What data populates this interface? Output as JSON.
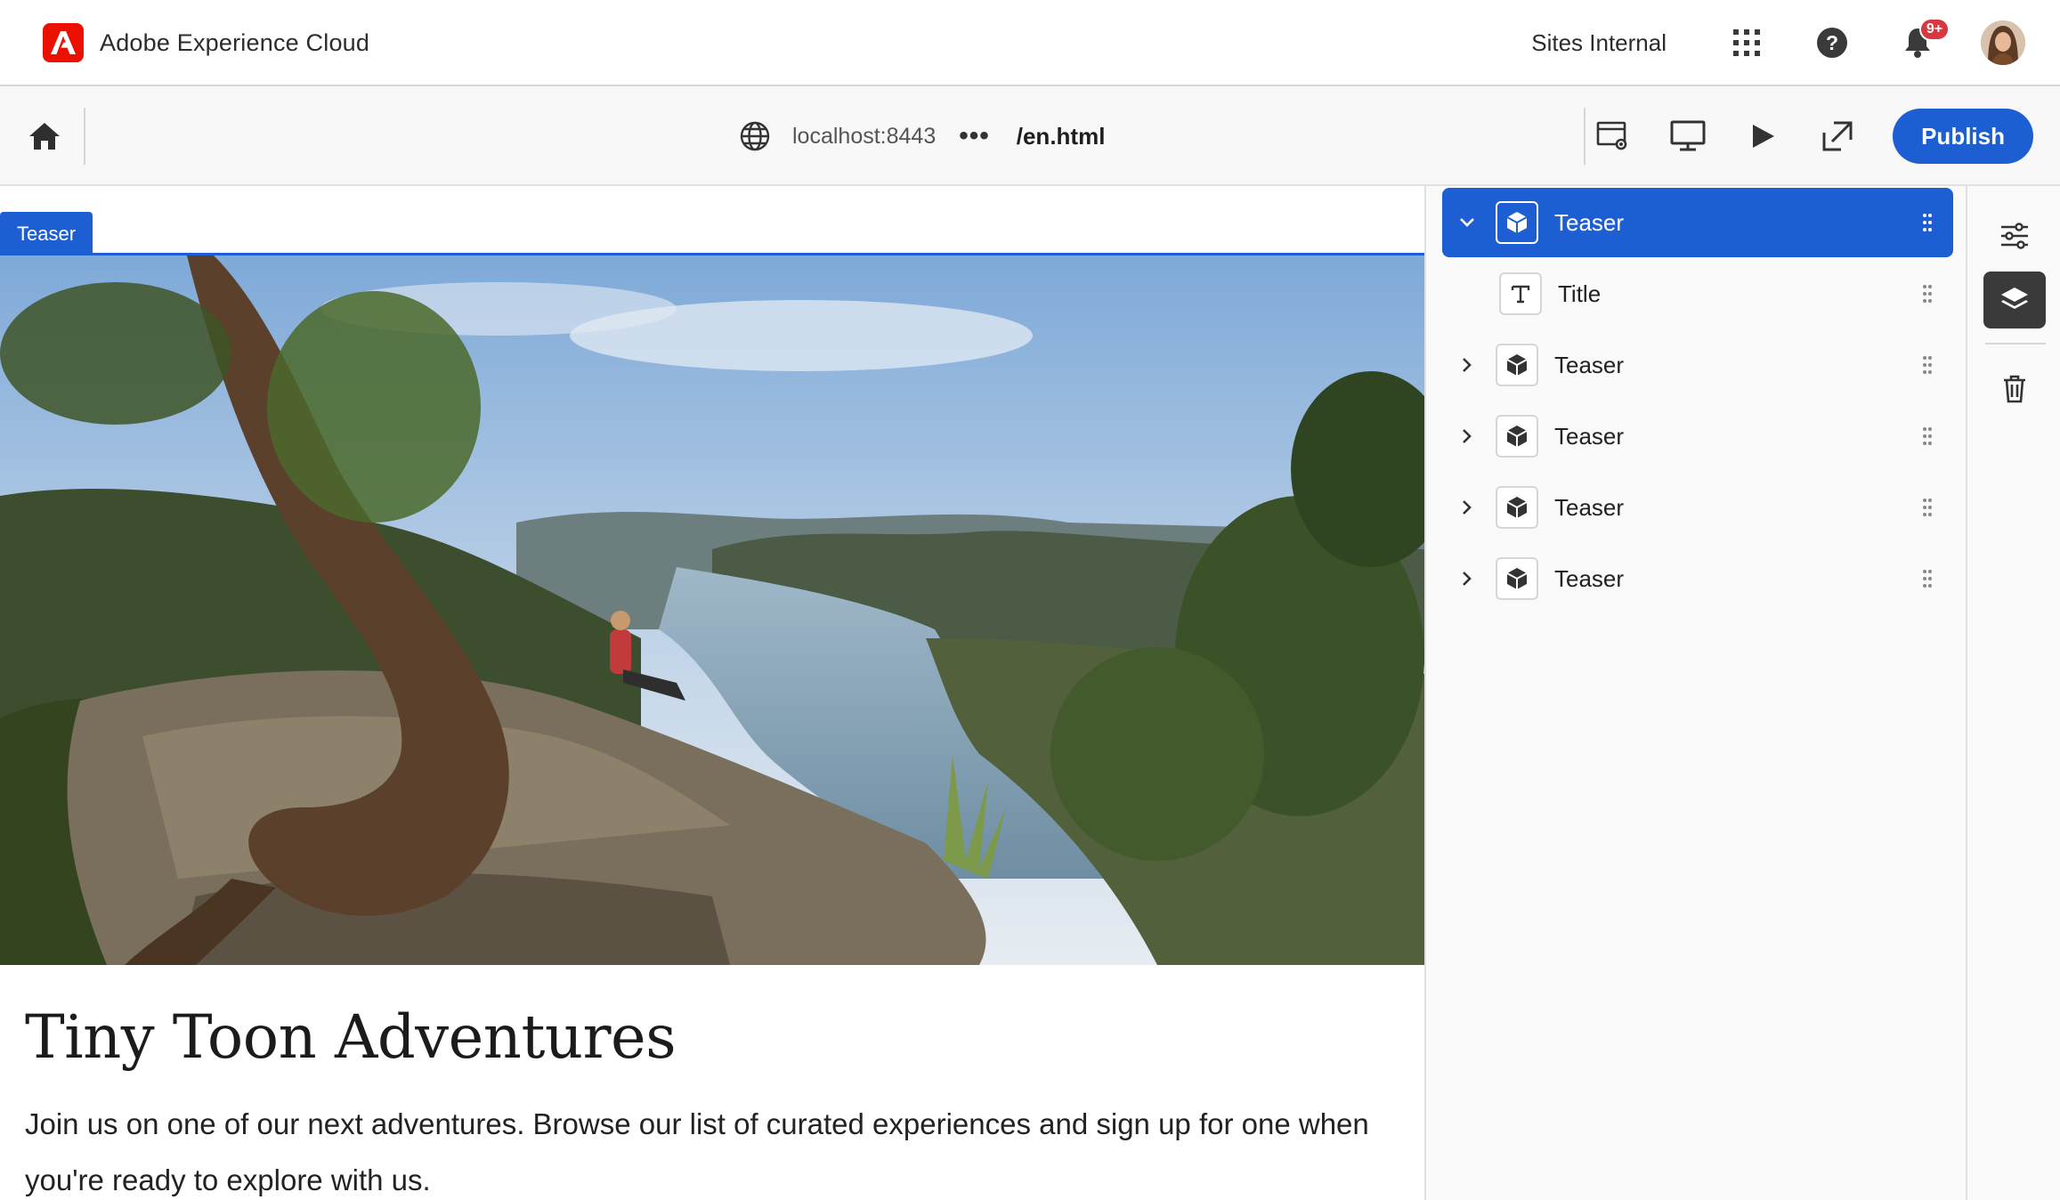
{
  "shell": {
    "brand_name": "Adobe Experience Cloud",
    "org_name": "Sites Internal",
    "notification_badge": "9+",
    "icons": [
      "app-switcher-icon",
      "help-icon",
      "bell-icon"
    ]
  },
  "toolbar": {
    "url_host": "localhost:8443",
    "url_more": "•••",
    "url_path": "/en.html",
    "publish_label": "Publish",
    "icons": [
      "home-icon",
      "globe-icon",
      "page-properties-icon",
      "desktop-icon",
      "preview-play-icon",
      "open-external-icon"
    ]
  },
  "canvas": {
    "component_tag": "Teaser",
    "teaser_title": "Tiny Toon Adventures",
    "teaser_description": "Join us on one of our next adventures. Browse our list of curated experiences and sign up for one when you're ready to explore with us."
  },
  "tree": {
    "items": [
      {
        "label": "Teaser",
        "expanded": true,
        "selected": true,
        "icon": "cube-icon"
      },
      {
        "label": "Title",
        "child": true,
        "icon": "text-icon"
      },
      {
        "label": "Teaser",
        "expanded": false,
        "icon": "cube-icon"
      },
      {
        "label": "Teaser",
        "expanded": false,
        "icon": "cube-icon"
      },
      {
        "label": "Teaser",
        "expanded": false,
        "icon": "cube-icon"
      },
      {
        "label": "Teaser",
        "expanded": false,
        "icon": "cube-icon"
      }
    ]
  },
  "rail": {
    "icons": [
      "properties-sliders-icon",
      "layers-icon",
      "trash-icon"
    ],
    "active": "layers-icon"
  },
  "colors": {
    "accent": "#1d5fd3",
    "adobe_red": "#eb1000",
    "badge_red": "#d7373f"
  }
}
